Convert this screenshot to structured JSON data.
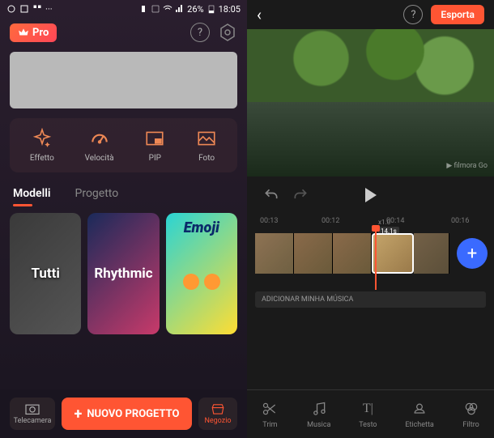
{
  "status": {
    "battery": "26%",
    "time": "18:05"
  },
  "pro_label": "Pro",
  "tools": [
    {
      "icon": "sparkle-icon",
      "label": "Effetto"
    },
    {
      "icon": "gauge-icon",
      "label": "Velocità"
    },
    {
      "icon": "pip-icon",
      "label": "PIP"
    },
    {
      "icon": "photo-icon",
      "label": "Foto"
    }
  ],
  "tabs": {
    "models": "Modelli",
    "project": "Progetto"
  },
  "templates": [
    {
      "label": "Tutti"
    },
    {
      "label": "Rhythmic"
    },
    {
      "label": "Emoji"
    }
  ],
  "bottom": {
    "camera": "Telecamera",
    "new_project": "NUOVO PROGETTO",
    "shop": "Negozio"
  },
  "editor": {
    "export": "Esporta",
    "watermark": "filmora Go",
    "times": {
      "t1": "00:13",
      "t2": "00:12",
      "t3": "00:14",
      "t4": "00:16"
    },
    "zoom": "x1.0",
    "clip_time": "14.1s",
    "music_label": "ADICIONAR MINHA MÚSICA",
    "tools": [
      {
        "icon": "scissors-icon",
        "label": "Trim"
      },
      {
        "icon": "music-icon",
        "label": "Musica"
      },
      {
        "icon": "text-icon",
        "label": "Testo"
      },
      {
        "icon": "tag-icon",
        "label": "Etichetta"
      },
      {
        "icon": "filter-icon",
        "label": "Filtro"
      }
    ]
  }
}
